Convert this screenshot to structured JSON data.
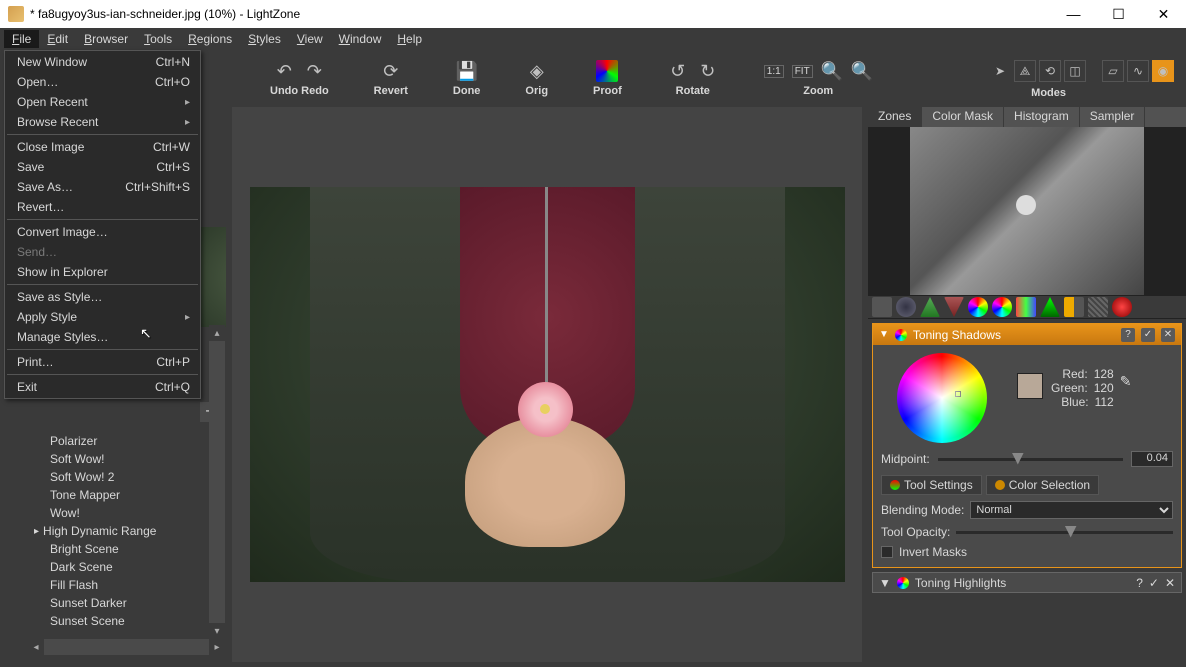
{
  "window": {
    "title": "* fa8ugyoy3us-ian-schneider.jpg (10%) - LightZone"
  },
  "menubar": [
    "File",
    "Edit",
    "Browser",
    "Tools",
    "Regions",
    "Styles",
    "View",
    "Window",
    "Help"
  ],
  "file_menu": [
    {
      "label": "New Window",
      "shortcut": "Ctrl+N",
      "type": "item"
    },
    {
      "label": "Open…",
      "shortcut": "Ctrl+O",
      "type": "item"
    },
    {
      "label": "Open Recent",
      "type": "submenu"
    },
    {
      "label": "Browse Recent",
      "type": "submenu"
    },
    {
      "type": "sep"
    },
    {
      "label": "Close Image",
      "shortcut": "Ctrl+W",
      "type": "item"
    },
    {
      "label": "Save",
      "shortcut": "Ctrl+S",
      "type": "item"
    },
    {
      "label": "Save As…",
      "shortcut": "Ctrl+Shift+S",
      "type": "item"
    },
    {
      "label": "Revert…",
      "type": "item"
    },
    {
      "type": "sep"
    },
    {
      "label": "Convert Image…",
      "type": "item"
    },
    {
      "label": "Send…",
      "type": "item",
      "disabled": true
    },
    {
      "label": "Show in Explorer",
      "type": "item"
    },
    {
      "type": "sep"
    },
    {
      "label": "Save as Style…",
      "type": "item"
    },
    {
      "label": "Apply Style",
      "type": "submenu"
    },
    {
      "label": "Manage Styles…",
      "type": "item"
    },
    {
      "type": "sep"
    },
    {
      "label": "Print…",
      "shortcut": "Ctrl+P",
      "type": "item"
    },
    {
      "type": "sep"
    },
    {
      "label": "Exit",
      "shortcut": "Ctrl+Q",
      "type": "item"
    }
  ],
  "toolbar": {
    "undo_redo": "Undo Redo",
    "revert": "Revert",
    "done": "Done",
    "orig": "Orig",
    "proof": "Proof",
    "rotate": "Rotate",
    "zoom": "Zoom",
    "modes": "Modes",
    "zoom_11": "1:1",
    "zoom_fit": "FIT"
  },
  "sidebar": {
    "items": [
      "Polarizer",
      "Soft Wow!",
      "Soft Wow! 2",
      "Tone Mapper",
      "Wow!"
    ],
    "group": "High Dynamic Range",
    "group_items": [
      "Bright Scene",
      "Dark Scene",
      "Fill Flash",
      "Sunset Darker",
      "Sunset Scene"
    ]
  },
  "right_tabs": [
    "Zones",
    "Color Mask",
    "Histogram",
    "Sampler"
  ],
  "toning_shadows": {
    "title": "Toning Shadows",
    "red_label": "Red:",
    "red": "128",
    "green_label": "Green:",
    "green": "120",
    "blue_label": "Blue:",
    "blue": "112",
    "midpoint_label": "Midpoint:",
    "midpoint_value": "0.04",
    "tool_settings": "Tool Settings",
    "color_selection": "Color Selection",
    "blending_label": "Blending Mode:",
    "blending_value": "Normal",
    "opacity_label": "Tool Opacity:",
    "invert_label": "Invert Masks"
  },
  "toning_highlights": {
    "title": "Toning Highlights"
  }
}
